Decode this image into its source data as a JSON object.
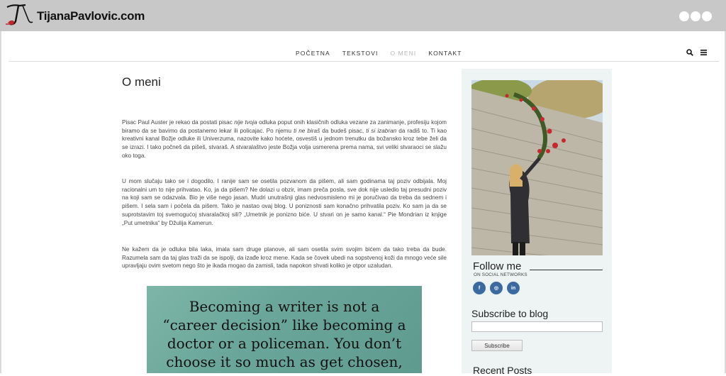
{
  "header": {
    "site_name": "TijanaPavlovic.com"
  },
  "nav": {
    "items": [
      {
        "label": "POČETNA",
        "active": false
      },
      {
        "label": "TEKSTOVI",
        "active": false
      },
      {
        "label": "O MENI",
        "active": true
      },
      {
        "label": "KONTAKT",
        "active": false
      }
    ],
    "icons": [
      "search-icon",
      "menu-icon"
    ]
  },
  "main": {
    "title": "O meni",
    "paragraphs": [
      "Pisac Paul Auster je rekao da postati pisac nije tvoja odluka poput onih klasičnih odluka vezane za zanimanje, profesiju kojom biramo da se bavimo da postanemo lekar ili policajac. Po njemu ti ne biraš da budeš pisac, ti si izabran da radiš to.  Ti kao kreativni kanal Božje odluke ili Univerzuma, nazovite kako hoćete, osvestiš u jednom trenutku da božansko kroz tebe želi da se izrazi. I tako počneš da pišeš, stvaraš. A stvaralaštvo jeste Božja volja usmerena prema nama, svi veliki stvaraoci se slažu oko toga.",
      "U mom slučaju tako se i dogodilo. I ranije sam se osetila pozvanom da pišem, ali sam godinama taj poziv odbijala. Moj racionalni um to nije prihvatao. Ko, ja da pišem? Ne dolazi u obzir, imam preča posla, sve dok nije usledio taj presudni poziv na koji sam se odazvala. Bio je više nego jasan. Mudri unutrašnji glas nedvosmisleno mi je poručivao da treba da sednem i pišem. I sela sam i počela da pišem. Tako je nastao ovaj blog. U poniznosti sam konačno prihvatila poziv. Ko sam ja da se suprotstavim toj svemogućoj stvaralačkoj sili? „Umetnik je ponizno biće. U stvari on je samo kanal.“ Pie Mondrian iz knjige „Put umetnika“ by Džulija Kamerun.",
      "Ne kažem da je odluka bila laka, imala sam druge planove, ali sam osetila svim svojim bićem da tako treba da bude. Razumela sam da taj glas traži da se ispolji, da izađe kroz mene. Kada se čovek ubedi na sopstvenoj koži da mnogo veće sile upravljaju ovim svetom nego što je ikada mogao da zamisli, tada napokon shvati koliko je otpor uzaludan."
    ],
    "quote_lines": [
      "Becoming a writer is not a",
      "“career decision” like becoming a",
      "doctor or a policeman. You don’t",
      "choose it so much as get chosen, and"
    ]
  },
  "sidebar": {
    "follow_title": "Follow me",
    "follow_subtitle": "ON SOCIAL NETWORKS",
    "socials": [
      {
        "icon": "facebook-icon",
        "glyph": "f"
      },
      {
        "icon": "instagram-icon",
        "glyph": "◎"
      },
      {
        "icon": "linkedin-icon",
        "glyph": "in"
      }
    ],
    "subscribe_title": "Subscribe to blog",
    "subscribe_input_value": "",
    "subscribe_button": "Subscribe",
    "recent_title": "Recent Posts"
  },
  "colors": {
    "header_bg": "#c8c8c8",
    "sidebar_bg": "#eef3f3",
    "social_blue": "#3b6aa0",
    "quote_teal": "#6aa79a",
    "nav_active": "#b5b5b5"
  }
}
